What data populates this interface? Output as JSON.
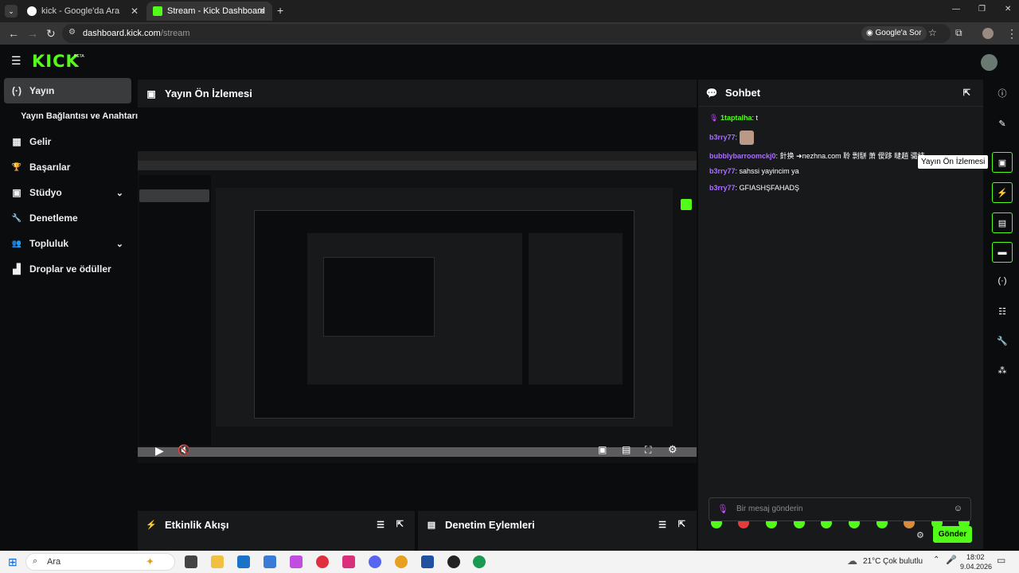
{
  "browser": {
    "tabs": [
      {
        "title": "kick - Google'da Ara",
        "close": "✕"
      },
      {
        "title": "Stream - Kick Dashboard",
        "close": "✕"
      }
    ],
    "new_tab": "+",
    "url_domain": "dashboard.kick.com",
    "url_path": "/stream",
    "google_ask": "Google'a Sor",
    "window_controls": [
      "—",
      "❐",
      "✕"
    ]
  },
  "app": {
    "logo": "KICK",
    "logo_badge": "BETA",
    "sidebar": [
      {
        "label": "Yayın",
        "icon": "(·)",
        "active": true
      },
      {
        "label": "Yayın Bağlantısı ve Anahtarı",
        "icon": "",
        "sub": true
      },
      {
        "label": "Gelir",
        "icon": "▦"
      },
      {
        "label": "Başarılar",
        "icon": "🏆"
      },
      {
        "label": "Stüdyo",
        "icon": "▣",
        "chevron": "⌄"
      },
      {
        "label": "Denetleme",
        "icon": "🔧"
      },
      {
        "label": "Topluluk",
        "icon": "👥",
        "chevron": "⌄"
      },
      {
        "label": "Droplar ve ödüller",
        "icon": "▟"
      }
    ],
    "preview_title": "Yayın Ön İzlemesi",
    "activity_title": "Etkinlik Akışı",
    "moderation_title": "Denetim Eylemleri",
    "chat": {
      "title": "Sohbet",
      "messages": [
        {
          "user": "1taptalha",
          "text": "t",
          "color": "#53fc18"
        },
        {
          "user": "b3rry77",
          "text": "",
          "color": "#a970ff"
        },
        {
          "user": "bubblybarroomckj0",
          "text": "針换 ➜nezhna.com 聆 剽駢 萧 僾跢 曃趙 骦结",
          "color": "#a970ff"
        },
        {
          "user": "b3rry77",
          "text": "sahssi yayincim ya",
          "color": "#a970ff"
        },
        {
          "user": "b3rry77",
          "text": "GFIASHŞFAHADŞ",
          "color": "#a970ff"
        }
      ],
      "input_placeholder": "Bir mesaj gönderin",
      "send_label": "Gönder"
    },
    "tooltip": "Yayın Ön İzlemesi"
  },
  "taskbar": {
    "search_placeholder": "Ara",
    "weather": "21°C",
    "weather_desc": "Çok bulutlu",
    "time": "18:02",
    "date": "9.04.2026"
  },
  "colors": {
    "accent": "#53fc18",
    "panel": "#18191b",
    "background": "#0b0c0e"
  }
}
